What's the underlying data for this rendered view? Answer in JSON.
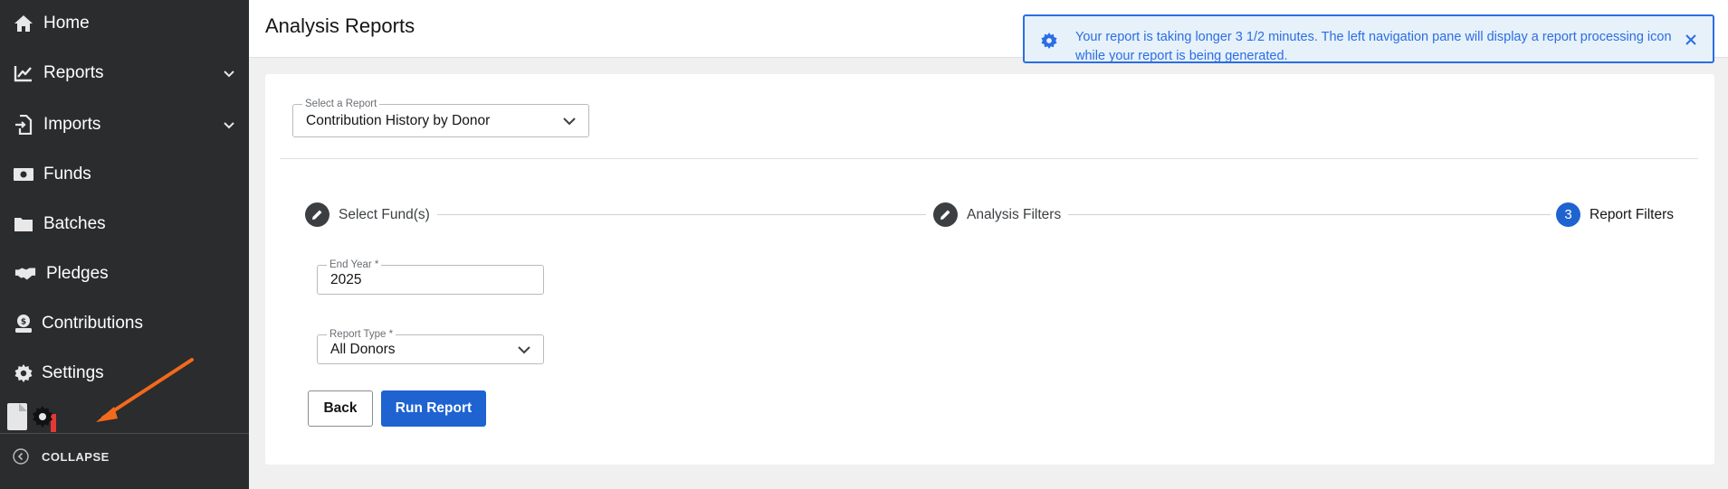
{
  "sidebar": {
    "items": [
      {
        "label": "Home",
        "icon": "home-icon"
      },
      {
        "label": "Reports",
        "icon": "chart-line-icon",
        "expandable": true
      },
      {
        "label": "Imports",
        "icon": "import-icon",
        "expandable": true
      },
      {
        "label": "Funds",
        "icon": "money-icon"
      },
      {
        "label": "Batches",
        "icon": "folder-icon"
      },
      {
        "label": "Pledges",
        "icon": "handshake-icon"
      },
      {
        "label": "Contributions",
        "icon": "donate-icon"
      },
      {
        "label": "Settings",
        "icon": "gear-icon"
      }
    ],
    "collapse_label": "COLLAPSE"
  },
  "header": {
    "title": "Analysis Reports"
  },
  "alert": {
    "message": "Your report is taking longer 3 1/2 minutes. The left navigation pane will display a report processing icon while your report is being generated."
  },
  "report_select": {
    "label": "Select a Report",
    "value": "Contribution History by Donor"
  },
  "wizard": {
    "steps": [
      {
        "label": "Select Fund(s)",
        "state": "completed"
      },
      {
        "label": "Analysis Filters",
        "state": "completed"
      },
      {
        "number": "3",
        "label": "Report Filters",
        "state": "current"
      }
    ]
  },
  "end_year": {
    "label": "End Year *",
    "value": "2025"
  },
  "report_type": {
    "label": "Report Type *",
    "value": "All Donors"
  },
  "buttons": {
    "back": "Back",
    "run": "Run Report"
  },
  "colors": {
    "sidebar_bg": "#2a2c2e",
    "accent": "#1e63d0",
    "alert_border": "#2b6ee3",
    "alert_bg": "#e7f1fa",
    "annotation_arrow": "#f26a1b"
  }
}
